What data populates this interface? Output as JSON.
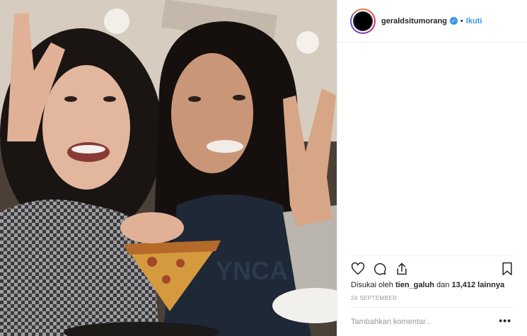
{
  "post": {
    "username": "geraldsitumorang",
    "separator": "•",
    "follow_label": "Ikuti",
    "likes_prefix": "Disukai oleh ",
    "liked_by": "tien_galuh",
    "likes_middle": " dan ",
    "likes_count": "13,412 lainnya",
    "date": "24 SEPTEMBER",
    "comment_placeholder": "Tambahkan komentar...",
    "more_label": "•••"
  },
  "icons": {
    "verified": "verified-badge-icon",
    "like": "heart-icon",
    "comment": "comment-icon",
    "share": "share-icon",
    "save": "bookmark-icon",
    "more": "more-options-icon"
  },
  "colors": {
    "accent": "#3897f0",
    "text": "#262626",
    "muted": "#999999",
    "border": "#efefef"
  }
}
